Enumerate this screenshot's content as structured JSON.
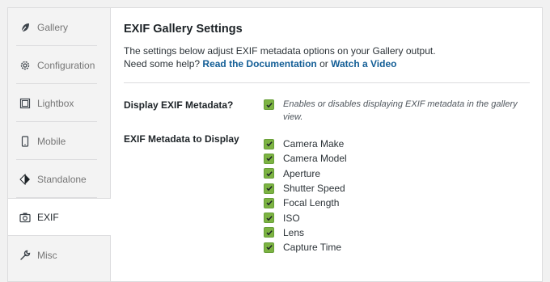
{
  "sidebar": {
    "items": [
      {
        "label": "Gallery",
        "icon": "leaf-icon",
        "active": false
      },
      {
        "label": "Configuration",
        "icon": "gear-icon",
        "active": false
      },
      {
        "label": "Lightbox",
        "icon": "lightbox-icon",
        "active": false
      },
      {
        "label": "Mobile",
        "icon": "mobile-icon",
        "active": false
      },
      {
        "label": "Standalone",
        "icon": "standalone-icon",
        "active": false
      },
      {
        "label": "EXIF",
        "icon": "camera-icon",
        "active": true
      },
      {
        "label": "Misc",
        "icon": "wrench-icon",
        "active": false
      }
    ]
  },
  "main": {
    "title": "EXIF Gallery Settings",
    "description_line1": "The settings below adjust EXIF metadata options on your Gallery output.",
    "help_prefix": "Need some help?",
    "doc_link": "Read the Documentation",
    "or_text": "or",
    "video_link": "Watch a Video"
  },
  "display_setting": {
    "label": "Display EXIF Metadata?",
    "checked": true,
    "hint": "Enables or disables displaying EXIF metadata in the gallery view."
  },
  "metadata_setting": {
    "label": "EXIF Metadata to Display",
    "options": [
      {
        "label": "Camera Make",
        "checked": true
      },
      {
        "label": "Camera Model",
        "checked": true
      },
      {
        "label": "Aperture",
        "checked": true
      },
      {
        "label": "Shutter Speed",
        "checked": true
      },
      {
        "label": "Focal Length",
        "checked": true
      },
      {
        "label": "ISO",
        "checked": true
      },
      {
        "label": "Lens",
        "checked": true
      },
      {
        "label": "Capture Time",
        "checked": true
      }
    ]
  },
  "colors": {
    "checkbox": "#7cb342",
    "link": "#135e96"
  }
}
